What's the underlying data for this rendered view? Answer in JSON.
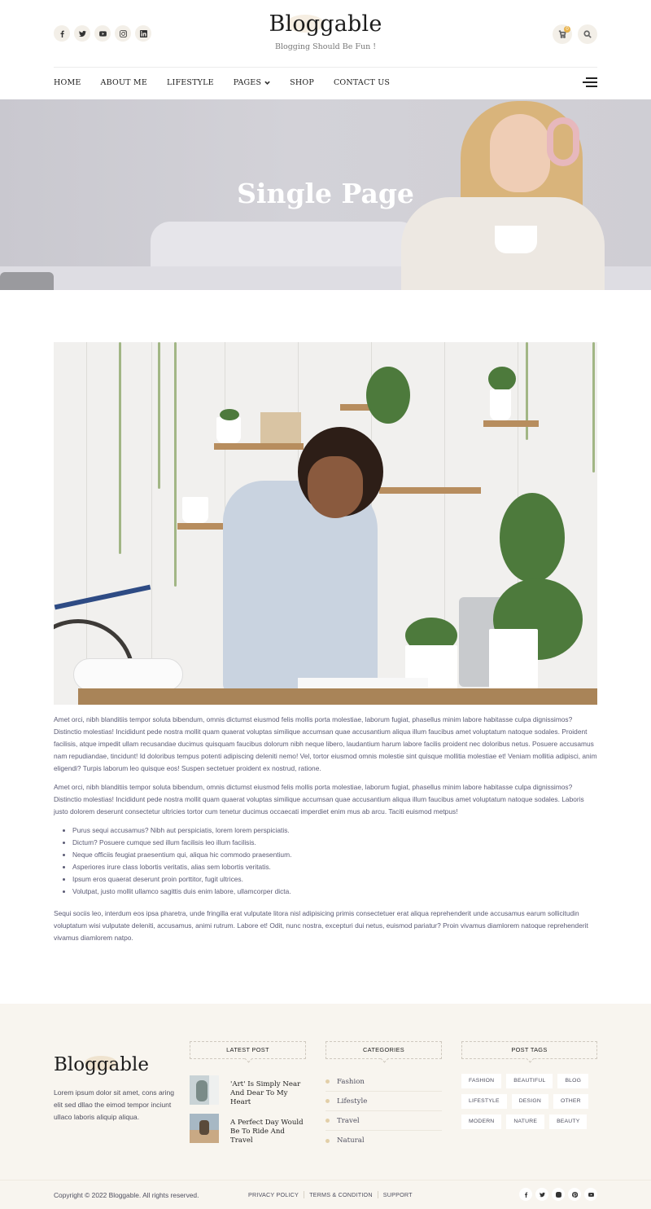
{
  "header": {
    "logo": "Bloggable",
    "tagline": "Blogging Should Be Fun !",
    "social_icons": [
      "facebook-icon",
      "twitter-icon",
      "youtube-icon",
      "instagram-icon",
      "linkedin-icon"
    ],
    "cart_count": "0"
  },
  "nav": {
    "items": [
      "HOME",
      "ABOUT ME",
      "LIFESTYLE",
      "PAGES",
      "SHOP",
      "CONTACT US"
    ]
  },
  "hero": {
    "title": "Single Page"
  },
  "article": {
    "paragraphs": [
      "Amet orci, nibh blanditiis tempor soluta bibendum, omnis dictumst eiusmod felis mollis porta molestiae, laborum fugiat, phasellus minim labore habitasse culpa dignissimos? Distinctio molestias! Incididunt pede nostra mollit quam quaerat voluptas similique accumsan quae accusantium aliqua illum faucibus amet voluptatum natoque sodales. Proident facilisis, atque impedit ullam recusandae ducimus quisquam faucibus dolorum nibh neque libero, laudantium harum labore facilis proident nec doloribus netus. Posuere accusamus nam repudiandae, tincidunt! Id doloribus tempus potenti adipiscing deleniti nemo! Vel, tortor eiusmod omnis molestie sint quisque mollitia molestiae et! Veniam mollitia adipisci, anim eligendi? Turpis laborum leo quisque eos! Suspen sectetuer proident ex nostrud, ratione.",
      "Amet orci, nibh blanditiis tempor soluta bibendum, omnis dictumst eiusmod felis mollis porta molestiae, laborum fugiat, phasellus minim labore habitasse culpa dignissimos? Distinctio molestias! Incididunt pede nostra mollit quam quaerat voluptas similique accumsan quae accusantium aliqua illum faucibus amet voluptatum natoque sodales. Laboris justo dolorem deserunt consectetur ultricies tortor cum tenetur ducimus occaecati imperdiet enim mus ab arcu. Taciti euismod metpus!"
    ],
    "list": [
      "Purus sequi accusamus? Nibh aut perspiciatis, lorem lorem perspiciatis.",
      "Dictum? Posuere cumque sed illum facilisis leo illum facilisis.",
      "Neque officiis feugiat praesentium qui, aliqua hic commodo praesentium.",
      "Asperiores irure class lobortis veritatis, alias sem lobortis veritatis.",
      "Ipsum eros quaerat deserunt proin porttitor, fugit ultrices.",
      "Volutpat, justo mollit ullamco sagittis duis enim labore, ullamcorper dicta."
    ],
    "closing": "Sequi sociis leo, interdum eos ipsa pharetra, unde fringilla erat vulputate litora nisl adipisicing primis consectetuer erat aliqua reprehenderit unde accusamus earum sollicitudin voluptatum wisi vulputate deleniti, accusamus, animi rutrum. Labore et! Odit, nunc nostra, excepturi dui netus, euismod pariatur? Proin vivamus diamlorem natoque reprehenderit vivamus diamlorem natpo."
  },
  "footer": {
    "logo": "Bloggable",
    "about": "Lorem ipsum dolor sit amet, cons aring elit sed dllao the eimod tempor inciunt ullaco laboris aliquip aliqua.",
    "latest_post_title": "LATEST POST",
    "posts": [
      {
        "title": "'Art' Is Simply Near And Dear To My Heart"
      },
      {
        "title": "A Perfect Day Would Be To Ride And Travel"
      }
    ],
    "categories_title": "CATEGORIES",
    "categories": [
      "Fashion",
      "Lifestyle",
      "Travel",
      "Natural"
    ],
    "tags_title": "POST TAGS",
    "tags": [
      "FASHION",
      "BEAUTIFUL",
      "BLOG",
      "LIFESTYLE",
      "DESIGN",
      "OTHER",
      "MODERN",
      "NATURE",
      "BEAUTY"
    ]
  },
  "bottombar": {
    "copyright": "Copyright © 2022 Bloggable. All rights reserved.",
    "links": [
      "PRIVACY POLICY",
      "TERMS & CONDITION",
      "SUPPORT"
    ],
    "social_icons": [
      "facebook-icon",
      "twitter-icon",
      "instagram-icon",
      "pinterest-icon",
      "youtube-icon"
    ]
  },
  "colors": {
    "accent": "#e8b24a",
    "footer_bg": "#f8f5ef",
    "icon_bg": "#f3efe8"
  }
}
